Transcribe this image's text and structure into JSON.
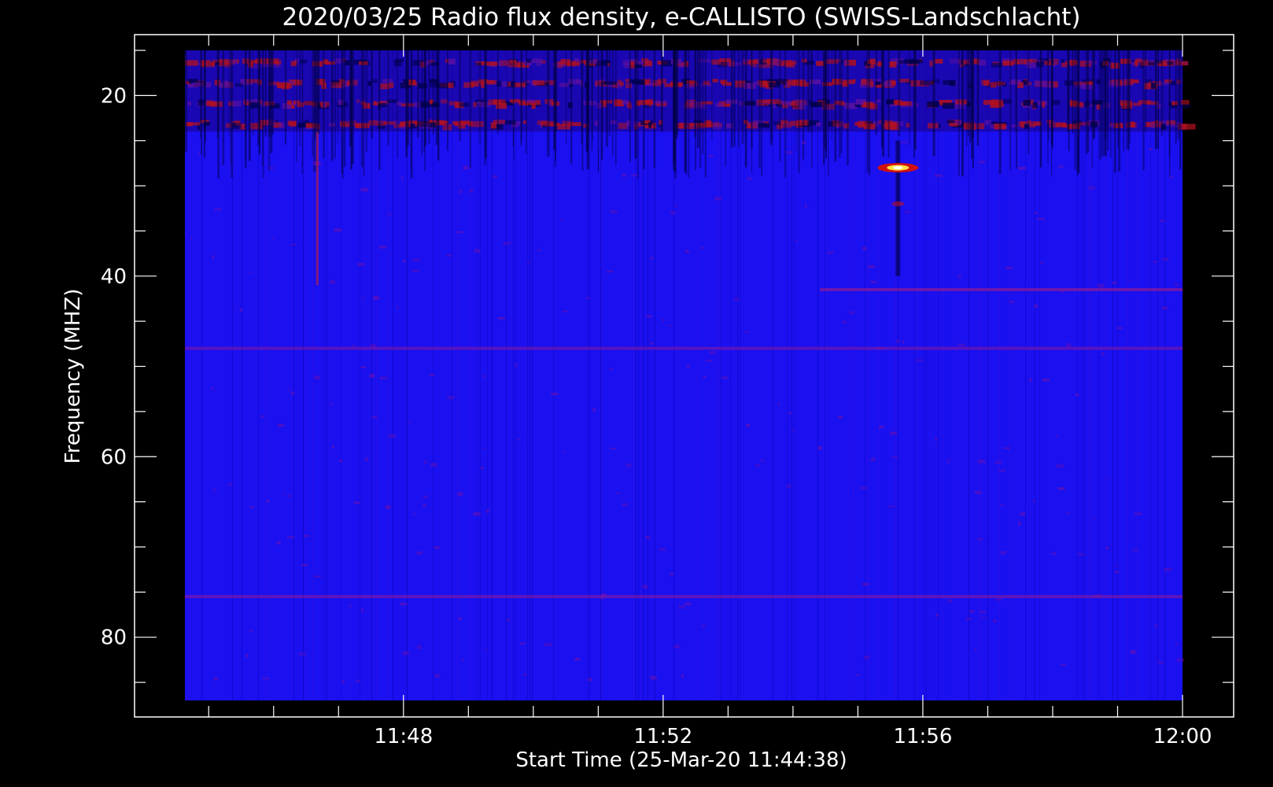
{
  "chart_data": {
    "type": "heatmap",
    "title": "2020/03/25  Radio flux density, e-CALLISTO (SWISS-Landschlacht)",
    "xlabel": "Start Time (25-Mar-20 11:44:38)",
    "ylabel": "Frequency (MHZ)",
    "x_unit": "time",
    "x_range": [
      "11:44:38",
      "12:00:00"
    ],
    "y_range": [
      15,
      87
    ],
    "y_inverted": true,
    "x_ticks": [
      "11:48",
      "11:52",
      "11:56",
      "12:00"
    ],
    "y_ticks": [
      20,
      40,
      60,
      80
    ],
    "colormap": [
      "#000000",
      "#0000ff",
      "#ff0000",
      "#ffff00",
      "#ffffff"
    ],
    "background_color": "#1a10f0",
    "features": [
      {
        "kind": "bright-burst",
        "time": "11:55:37",
        "freq_mhz": 28.0,
        "intensity": 1.0
      },
      {
        "kind": "spot",
        "time": "11:55:37",
        "freq_mhz": 32.0,
        "intensity": 0.6
      },
      {
        "kind": "interference-line",
        "time_start": "11:54:25",
        "time_end": "12:00:00",
        "freq_mhz": 41.5,
        "intensity": 0.45
      },
      {
        "kind": "interference-line",
        "time_start": "11:44:38",
        "time_end": "12:00:00",
        "freq_mhz": 48.0,
        "intensity": 0.25
      },
      {
        "kind": "interference-line",
        "time_start": "11:44:38",
        "time_end": "12:00:00",
        "freq_mhz": 75.5,
        "intensity": 0.3
      },
      {
        "kind": "vertical-streak",
        "time": "11:46:40",
        "freq_start_mhz": 24,
        "freq_end_mhz": 41,
        "intensity": 0.4
      },
      {
        "kind": "band-noise",
        "freq_start_mhz": 15,
        "freq_end_mhz": 24,
        "intensity": 0.7
      }
    ]
  }
}
